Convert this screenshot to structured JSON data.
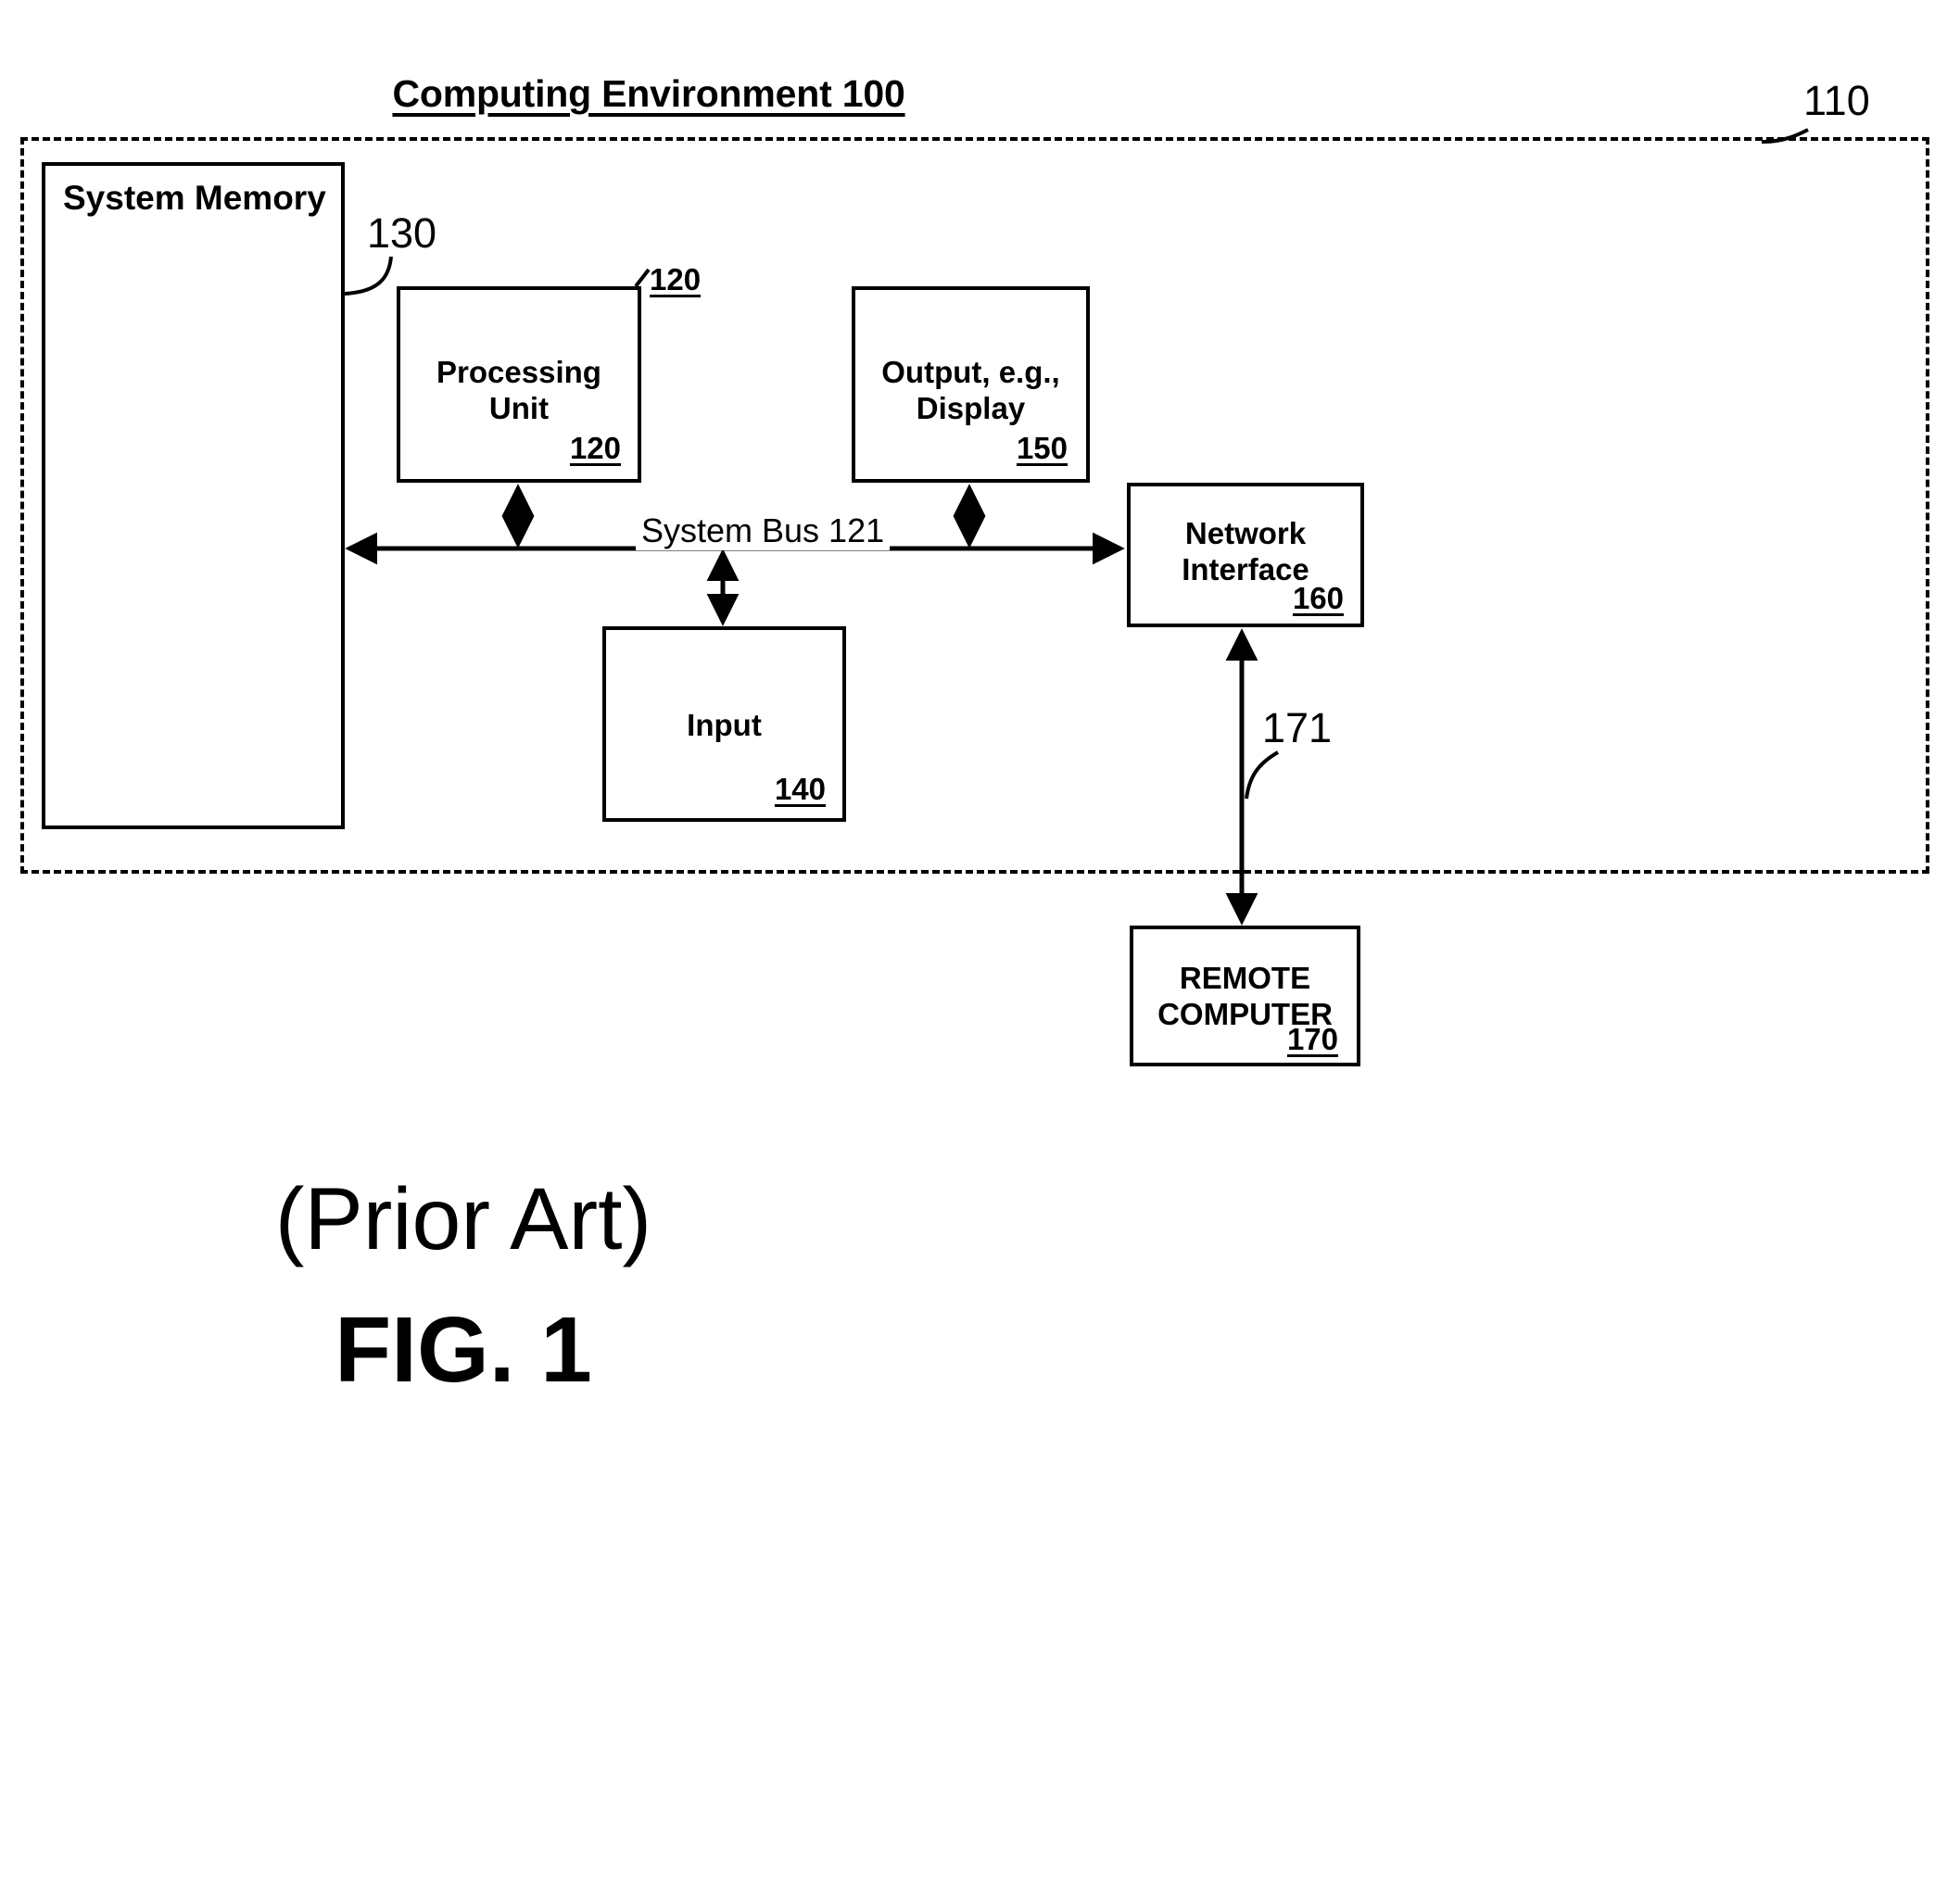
{
  "figure": {
    "title": "Computing Environment 100",
    "prior_art_caption": "(Prior Art)",
    "figure_number": "FIG. 1"
  },
  "environment": {
    "ref": "110"
  },
  "blocks": {
    "system_memory": {
      "label": "System Memory",
      "ref": "130"
    },
    "processing_unit": {
      "label_line1": "Processing",
      "label_line2": "Unit",
      "ref_inside": "120",
      "ref_outside": "120"
    },
    "output": {
      "label_line1": "Output, e.g.,",
      "label_line2": "Display",
      "ref_inside": "150"
    },
    "input": {
      "label": "Input",
      "ref_inside": "140"
    },
    "network_interface": {
      "label_line1": "Network",
      "label_line2": "Interface",
      "ref_inside": "160"
    },
    "remote_computer": {
      "label_line1": "REMOTE",
      "label_line2": "COMPUTER",
      "ref_inside": "170"
    }
  },
  "connections": {
    "system_bus_label": "System Bus 121",
    "network_link_ref": "171"
  },
  "colors": {
    "ink": "#000000",
    "paper": "#ffffff"
  }
}
